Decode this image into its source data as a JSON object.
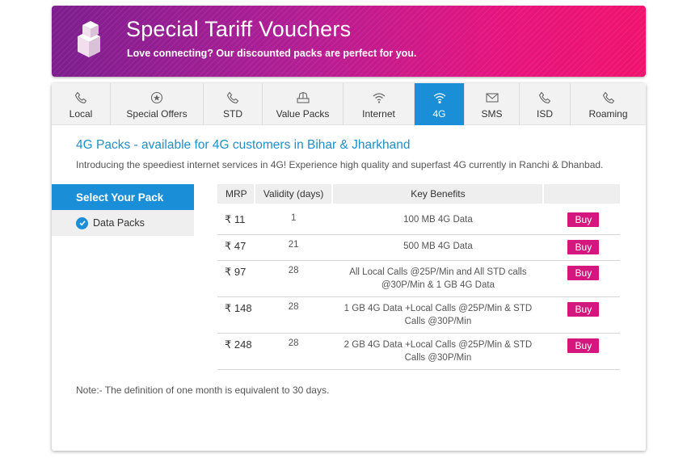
{
  "banner": {
    "title": "Special Tariff Vouchers",
    "subtitle": "Love connecting? Our discounted packs are perfect for you.",
    "icon": "stacked-boxes-icon"
  },
  "tabs": [
    {
      "label": "Local",
      "icon": "phone-icon",
      "active": false
    },
    {
      "label": "Special Offers",
      "icon": "star-badge-icon",
      "active": false
    },
    {
      "label": "STD",
      "icon": "phone-icon",
      "active": false
    },
    {
      "label": "Value Packs",
      "icon": "value-pack-icon",
      "active": false
    },
    {
      "label": "Internet",
      "icon": "wifi-icon",
      "active": false
    },
    {
      "label": "4G",
      "icon": "wifi-icon",
      "active": true
    },
    {
      "label": "SMS",
      "icon": "envelope-icon",
      "active": false
    },
    {
      "label": "ISD",
      "icon": "phone-icon",
      "active": false
    },
    {
      "label": "Roaming",
      "icon": "phone-icon",
      "active": false
    }
  ],
  "section": {
    "title": "4G Packs - available for 4G customers in Bihar & Jharkhand",
    "description": "Introducing the speediest internet services in 4G! Experience high quality and superfast 4G currently in Ranchi & Dhanbad."
  },
  "sidebar": {
    "heading": "Select Your Pack",
    "items": [
      {
        "label": "Data Packs",
        "selected": true
      }
    ]
  },
  "table": {
    "headers": {
      "mrp": "MRP",
      "validity": "Validity (days)",
      "benefits": "Key Benefits",
      "action": ""
    },
    "rows": [
      {
        "mrp": "₹ 11",
        "validity": "1",
        "benefits": "100 MB 4G Data",
        "buy": "Buy"
      },
      {
        "mrp": "₹ 47",
        "validity": "21",
        "benefits": "500 MB 4G Data",
        "buy": "Buy"
      },
      {
        "mrp": "₹ 97",
        "validity": "28",
        "benefits": "All Local Calls @25P/Min and All STD calls @30P/Min & 1 GB 4G Data",
        "buy": "Buy"
      },
      {
        "mrp": "₹ 148",
        "validity": "28",
        "benefits": "1 GB 4G Data +Local Calls @25P/Min & STD Calls @30P/Min",
        "buy": "Buy"
      },
      {
        "mrp": "₹ 248",
        "validity": "28",
        "benefits": "2 GB 4G Data +Local Calls @25P/Min & STD Calls @30P/Min",
        "buy": "Buy"
      }
    ]
  },
  "note": "Note:- The definition of one month is equivalent to 30 days.",
  "colors": {
    "accent_blue": "#1a8fd8",
    "buy_magenta": "#d4177f",
    "banner_start": "#7d1e8f",
    "banner_end": "#f0136e"
  }
}
